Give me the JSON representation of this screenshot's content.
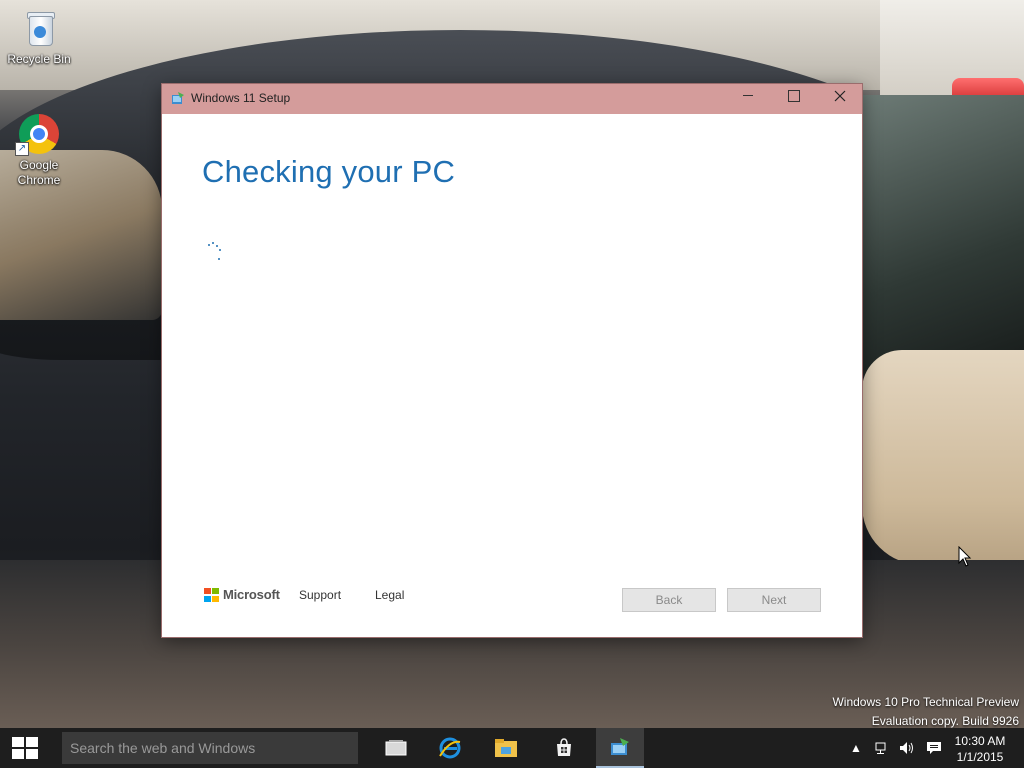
{
  "desktop": {
    "icons": [
      {
        "label": "Recycle Bin"
      },
      {
        "label": "Google Chrome"
      }
    ],
    "watermark": {
      "line1": "Windows 10 Pro Technical Preview",
      "line2": "Evaluation copy. Build 9926"
    }
  },
  "window": {
    "title": "Windows 11 Setup",
    "heading": "Checking your PC",
    "footer": {
      "brand": "Microsoft",
      "links": [
        "Support",
        "Legal"
      ],
      "back_label": "Back",
      "next_label": "Next"
    }
  },
  "taskbar": {
    "search_placeholder": "Search the web and Windows",
    "apps": [
      "task-view-icon",
      "internet-explorer-icon",
      "file-explorer-icon",
      "store-icon",
      "windows-setup-icon"
    ],
    "clock_time": "10:30 AM",
    "clock_date": "1/1/2015"
  },
  "colors": {
    "titlebar": "#d49c9b",
    "heading": "#1f6fb2",
    "taskbar": "#1e1e1e"
  }
}
